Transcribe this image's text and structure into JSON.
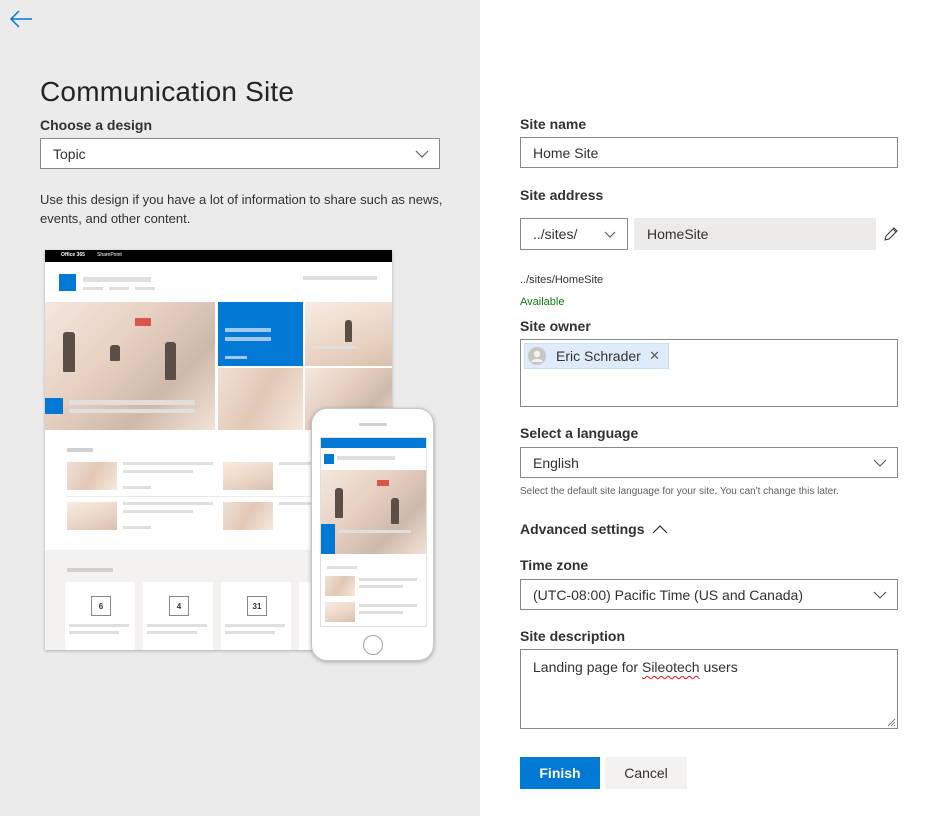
{
  "left": {
    "title": "Communication Site",
    "design_label": "Choose a design",
    "design_value": "Topic",
    "description": "Use this design if you have a lot of information to share such as news, events, and other content.",
    "preview": {
      "suite_name": "Office 365",
      "app_name": "SharePoint",
      "event_dates": [
        "6",
        "4",
        "31"
      ]
    }
  },
  "form": {
    "site_name_label": "Site name",
    "site_name_value": "Home Site",
    "site_address_label": "Site address",
    "address_prefix": "../sites/",
    "address_value": "HomeSite",
    "address_preview": "../sites/HomeSite",
    "availability": "Available",
    "owner_label": "Site owner",
    "owner_name": "Eric Schrader",
    "language_label": "Select a language",
    "language_value": "English",
    "language_hint": "Select the default site language for your site. You can't change this later.",
    "advanced_label": "Advanced settings",
    "timezone_label": "Time zone",
    "timezone_value": "(UTC-08:00) Pacific Time (US and Canada)",
    "description_label": "Site description",
    "description_value_prefix": "Landing page for ",
    "description_value_word": "Sileotech",
    "description_value_suffix": " users"
  },
  "buttons": {
    "finish": "Finish",
    "cancel": "Cancel"
  },
  "icons": {
    "back": "back-arrow-icon",
    "chevron": "chevron-down-icon",
    "chevron_up": "chevron-up-icon",
    "edit": "pencil-icon",
    "remove": "close-icon",
    "avatar": "person-icon"
  },
  "colors": {
    "accent": "#0078d4",
    "left_bg": "#ebebeb",
    "available": "#107c10"
  }
}
